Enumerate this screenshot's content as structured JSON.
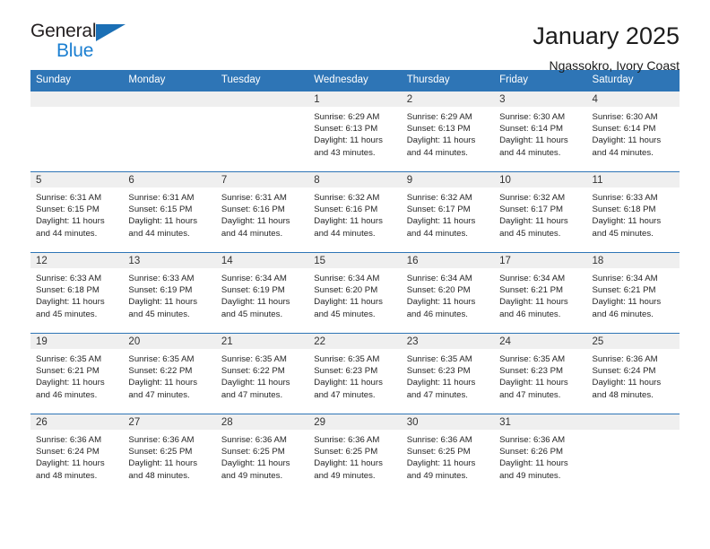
{
  "brand": {
    "name_part1": "General",
    "name_part2": "Blue",
    "triangle_color": "#1b6fb5",
    "blue_color": "#1b7fd1"
  },
  "header": {
    "title": "January 2025",
    "location": "Ngassokro, Ivory Coast"
  },
  "theme": {
    "header_bg": "#2e75b6",
    "daynum_bg": "#efefef",
    "text_color": "#262626"
  },
  "weekdays": [
    "Sunday",
    "Monday",
    "Tuesday",
    "Wednesday",
    "Thursday",
    "Friday",
    "Saturday"
  ],
  "labels": {
    "sunrise_prefix": "Sunrise:",
    "sunset_prefix": "Sunset:",
    "daylight_prefix": "Daylight:"
  },
  "weeks": [
    [
      {
        "day": "",
        "empty": true
      },
      {
        "day": "",
        "empty": true
      },
      {
        "day": "",
        "empty": true
      },
      {
        "day": "1",
        "sunrise": "Sunrise: 6:29 AM",
        "sunset": "Sunset: 6:13 PM",
        "daylight_line1": "Daylight: 11 hours",
        "daylight_line2": "and 43 minutes."
      },
      {
        "day": "2",
        "sunrise": "Sunrise: 6:29 AM",
        "sunset": "Sunset: 6:13 PM",
        "daylight_line1": "Daylight: 11 hours",
        "daylight_line2": "and 44 minutes."
      },
      {
        "day": "3",
        "sunrise": "Sunrise: 6:30 AM",
        "sunset": "Sunset: 6:14 PM",
        "daylight_line1": "Daylight: 11 hours",
        "daylight_line2": "and 44 minutes."
      },
      {
        "day": "4",
        "sunrise": "Sunrise: 6:30 AM",
        "sunset": "Sunset: 6:14 PM",
        "daylight_line1": "Daylight: 11 hours",
        "daylight_line2": "and 44 minutes."
      }
    ],
    [
      {
        "day": "5",
        "sunrise": "Sunrise: 6:31 AM",
        "sunset": "Sunset: 6:15 PM",
        "daylight_line1": "Daylight: 11 hours",
        "daylight_line2": "and 44 minutes."
      },
      {
        "day": "6",
        "sunrise": "Sunrise: 6:31 AM",
        "sunset": "Sunset: 6:15 PM",
        "daylight_line1": "Daylight: 11 hours",
        "daylight_line2": "and 44 minutes."
      },
      {
        "day": "7",
        "sunrise": "Sunrise: 6:31 AM",
        "sunset": "Sunset: 6:16 PM",
        "daylight_line1": "Daylight: 11 hours",
        "daylight_line2": "and 44 minutes."
      },
      {
        "day": "8",
        "sunrise": "Sunrise: 6:32 AM",
        "sunset": "Sunset: 6:16 PM",
        "daylight_line1": "Daylight: 11 hours",
        "daylight_line2": "and 44 minutes."
      },
      {
        "day": "9",
        "sunrise": "Sunrise: 6:32 AM",
        "sunset": "Sunset: 6:17 PM",
        "daylight_line1": "Daylight: 11 hours",
        "daylight_line2": "and 44 minutes."
      },
      {
        "day": "10",
        "sunrise": "Sunrise: 6:32 AM",
        "sunset": "Sunset: 6:17 PM",
        "daylight_line1": "Daylight: 11 hours",
        "daylight_line2": "and 45 minutes."
      },
      {
        "day": "11",
        "sunrise": "Sunrise: 6:33 AM",
        "sunset": "Sunset: 6:18 PM",
        "daylight_line1": "Daylight: 11 hours",
        "daylight_line2": "and 45 minutes."
      }
    ],
    [
      {
        "day": "12",
        "sunrise": "Sunrise: 6:33 AM",
        "sunset": "Sunset: 6:18 PM",
        "daylight_line1": "Daylight: 11 hours",
        "daylight_line2": "and 45 minutes."
      },
      {
        "day": "13",
        "sunrise": "Sunrise: 6:33 AM",
        "sunset": "Sunset: 6:19 PM",
        "daylight_line1": "Daylight: 11 hours",
        "daylight_line2": "and 45 minutes."
      },
      {
        "day": "14",
        "sunrise": "Sunrise: 6:34 AM",
        "sunset": "Sunset: 6:19 PM",
        "daylight_line1": "Daylight: 11 hours",
        "daylight_line2": "and 45 minutes."
      },
      {
        "day": "15",
        "sunrise": "Sunrise: 6:34 AM",
        "sunset": "Sunset: 6:20 PM",
        "daylight_line1": "Daylight: 11 hours",
        "daylight_line2": "and 45 minutes."
      },
      {
        "day": "16",
        "sunrise": "Sunrise: 6:34 AM",
        "sunset": "Sunset: 6:20 PM",
        "daylight_line1": "Daylight: 11 hours",
        "daylight_line2": "and 46 minutes."
      },
      {
        "day": "17",
        "sunrise": "Sunrise: 6:34 AM",
        "sunset": "Sunset: 6:21 PM",
        "daylight_line1": "Daylight: 11 hours",
        "daylight_line2": "and 46 minutes."
      },
      {
        "day": "18",
        "sunrise": "Sunrise: 6:34 AM",
        "sunset": "Sunset: 6:21 PM",
        "daylight_line1": "Daylight: 11 hours",
        "daylight_line2": "and 46 minutes."
      }
    ],
    [
      {
        "day": "19",
        "sunrise": "Sunrise: 6:35 AM",
        "sunset": "Sunset: 6:21 PM",
        "daylight_line1": "Daylight: 11 hours",
        "daylight_line2": "and 46 minutes."
      },
      {
        "day": "20",
        "sunrise": "Sunrise: 6:35 AM",
        "sunset": "Sunset: 6:22 PM",
        "daylight_line1": "Daylight: 11 hours",
        "daylight_line2": "and 47 minutes."
      },
      {
        "day": "21",
        "sunrise": "Sunrise: 6:35 AM",
        "sunset": "Sunset: 6:22 PM",
        "daylight_line1": "Daylight: 11 hours",
        "daylight_line2": "and 47 minutes."
      },
      {
        "day": "22",
        "sunrise": "Sunrise: 6:35 AM",
        "sunset": "Sunset: 6:23 PM",
        "daylight_line1": "Daylight: 11 hours",
        "daylight_line2": "and 47 minutes."
      },
      {
        "day": "23",
        "sunrise": "Sunrise: 6:35 AM",
        "sunset": "Sunset: 6:23 PM",
        "daylight_line1": "Daylight: 11 hours",
        "daylight_line2": "and 47 minutes."
      },
      {
        "day": "24",
        "sunrise": "Sunrise: 6:35 AM",
        "sunset": "Sunset: 6:23 PM",
        "daylight_line1": "Daylight: 11 hours",
        "daylight_line2": "and 47 minutes."
      },
      {
        "day": "25",
        "sunrise": "Sunrise: 6:36 AM",
        "sunset": "Sunset: 6:24 PM",
        "daylight_line1": "Daylight: 11 hours",
        "daylight_line2": "and 48 minutes."
      }
    ],
    [
      {
        "day": "26",
        "sunrise": "Sunrise: 6:36 AM",
        "sunset": "Sunset: 6:24 PM",
        "daylight_line1": "Daylight: 11 hours",
        "daylight_line2": "and 48 minutes."
      },
      {
        "day": "27",
        "sunrise": "Sunrise: 6:36 AM",
        "sunset": "Sunset: 6:25 PM",
        "daylight_line1": "Daylight: 11 hours",
        "daylight_line2": "and 48 minutes."
      },
      {
        "day": "28",
        "sunrise": "Sunrise: 6:36 AM",
        "sunset": "Sunset: 6:25 PM",
        "daylight_line1": "Daylight: 11 hours",
        "daylight_line2": "and 49 minutes."
      },
      {
        "day": "29",
        "sunrise": "Sunrise: 6:36 AM",
        "sunset": "Sunset: 6:25 PM",
        "daylight_line1": "Daylight: 11 hours",
        "daylight_line2": "and 49 minutes."
      },
      {
        "day": "30",
        "sunrise": "Sunrise: 6:36 AM",
        "sunset": "Sunset: 6:25 PM",
        "daylight_line1": "Daylight: 11 hours",
        "daylight_line2": "and 49 minutes."
      },
      {
        "day": "31",
        "sunrise": "Sunrise: 6:36 AM",
        "sunset": "Sunset: 6:26 PM",
        "daylight_line1": "Daylight: 11 hours",
        "daylight_line2": "and 49 minutes."
      },
      {
        "day": "",
        "empty": true
      }
    ]
  ]
}
